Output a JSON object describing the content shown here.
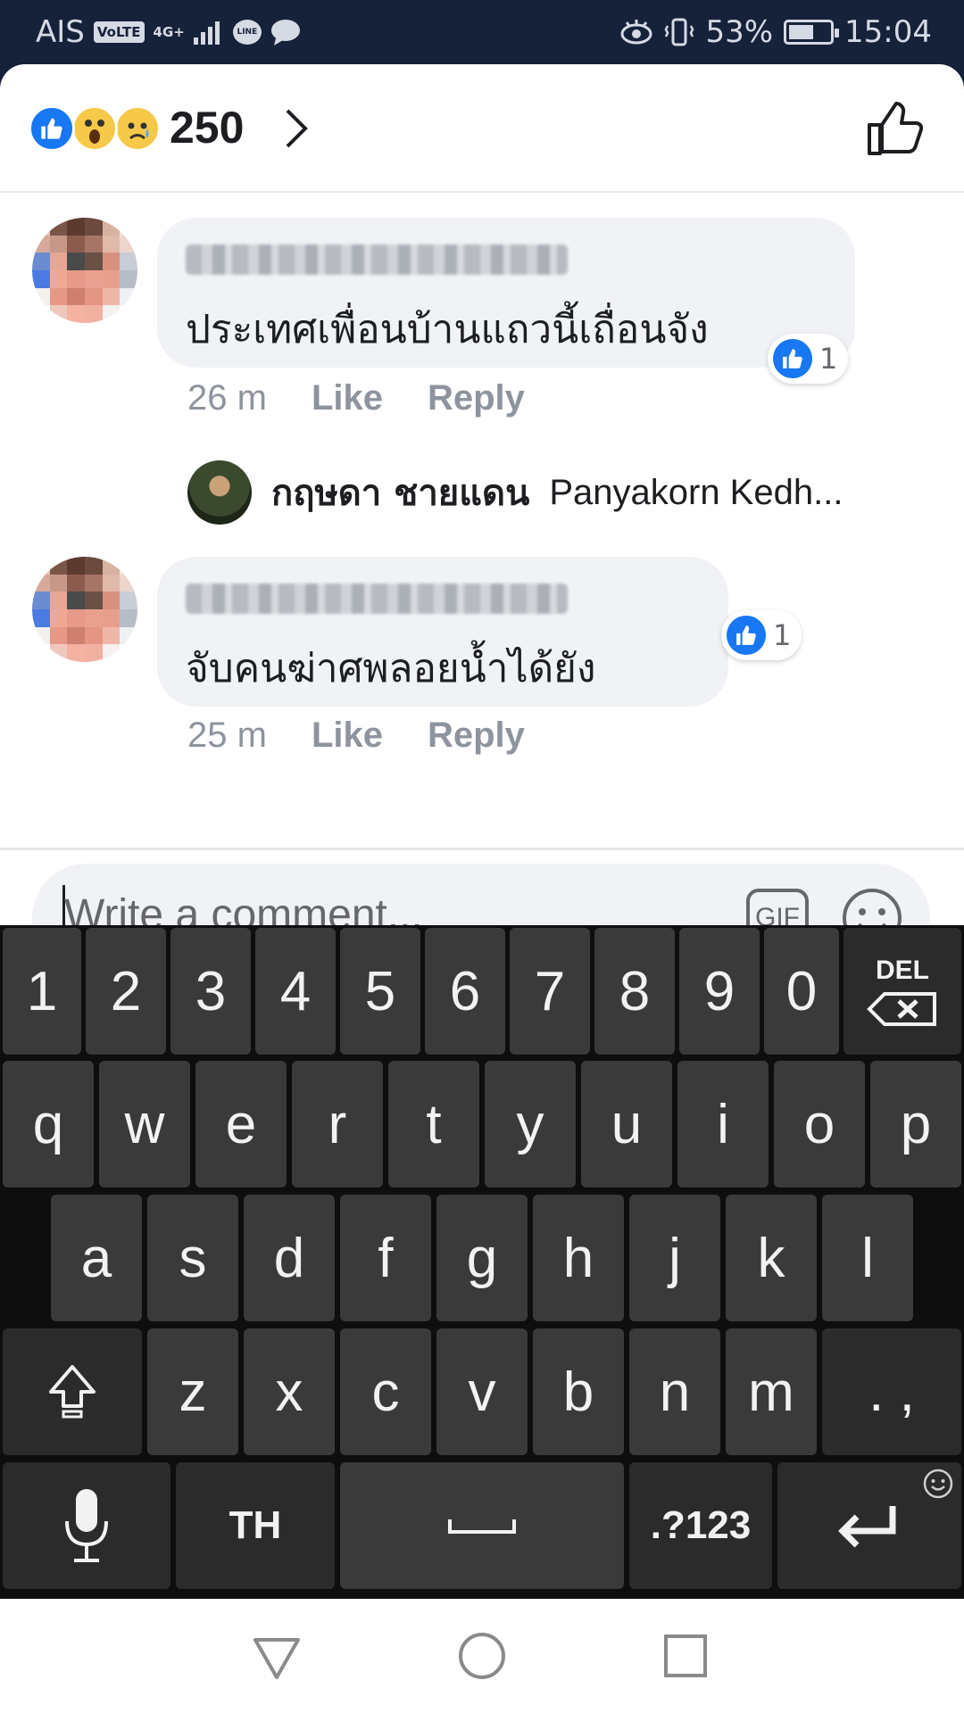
{
  "status_bar": {
    "carrier": "AIS",
    "volte": "VoLTE",
    "network": "4G+",
    "battery_percent": "53%",
    "time": "15:04",
    "battery_level": 0.53
  },
  "reactions": {
    "count": "250",
    "icons": [
      "like-icon",
      "wow-icon",
      "sad-icon"
    ]
  },
  "comments": [
    {
      "text": "ประเทศเพื่อนบ้านแถวนี้เถื่อนจัง",
      "time": "26 m",
      "like_label": "Like",
      "reply_label": "Reply",
      "like_count": "1"
    },
    {
      "text": "จับคนฆ่าศพลอยน้ำได้ยัง",
      "time": "25 m",
      "like_label": "Like",
      "reply_label": "Reply",
      "like_count": "1"
    }
  ],
  "reply_preview": {
    "author": "กฤษดา ชายแดน",
    "text": "Panyakorn Kedh..."
  },
  "composer": {
    "placeholder": "Write a comment...",
    "gif_label": "GIF"
  },
  "keyboard": {
    "row_numbers": [
      "1",
      "2",
      "3",
      "4",
      "5",
      "6",
      "7",
      "8",
      "9",
      "0"
    ],
    "delete_label": "DEL",
    "row1": [
      "q",
      "w",
      "e",
      "r",
      "t",
      "y",
      "u",
      "i",
      "o",
      "p"
    ],
    "row2": [
      "a",
      "s",
      "d",
      "f",
      "g",
      "h",
      "j",
      "k",
      "l"
    ],
    "row3": [
      "z",
      "x",
      "c",
      "v",
      "b",
      "n",
      "m",
      ". ,"
    ],
    "language_label": "TH",
    "symbols_label": ".?123"
  },
  "colors": {
    "status_bar_bg": "#16213a",
    "facebook_blue": "#1877f2",
    "bubble_bg": "#f0f2f5",
    "keyboard_bg": "#0e0e0e",
    "key_bg": "#3a3a3a"
  }
}
